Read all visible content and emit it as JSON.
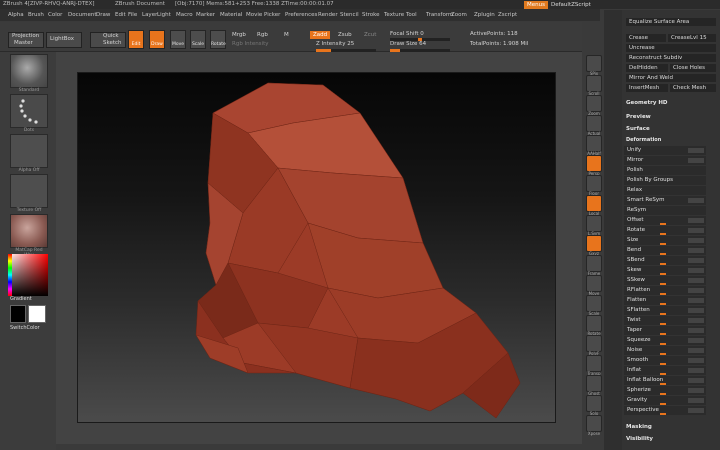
{
  "titlebar": {
    "app": "ZBrush 4[ZIVP-RHVQ-ANRJ-DTEX]",
    "doc": "ZBrush Document",
    "stats": "[Obj:7170] Mems:581+253 Free:1338 ZTime:00:00:01.07",
    "menus": "Menus",
    "script": "DefaultZScript"
  },
  "menubar": [
    "Alpha",
    "Brush",
    "Color",
    "Document",
    "Draw",
    "Edit",
    "File",
    "Layer",
    "Light",
    "Macro",
    "Marker",
    "Material",
    "Movie",
    "Picker",
    "Preferences",
    "Render",
    "Stencil",
    "Stroke",
    "Texture",
    "Tool",
    "Transform",
    "Zoom",
    "Zplugin",
    "Zscript"
  ],
  "toolbar": {
    "projection": "Projection",
    "master": "Master",
    "lightbox": "LightBox",
    "quick": "Quick",
    "sketch": "Sketch",
    "edit": "Edit",
    "draw": "Draw",
    "move": "Move",
    "scale": "Scale",
    "rotate": "Rotate",
    "mrgb": "Mrgb",
    "rgb": "Rgb",
    "m": "M",
    "zadd": "Zadd",
    "zsub": "Zsub",
    "zcut": "Zcut",
    "rgb_intensity": "Rgb Intensity",
    "z_intensity": "Z Intensity 25",
    "focal_shift": "Focal Shift 0",
    "draw_size": "Draw Size 64",
    "active_points": "ActivePoints: 118",
    "total_points": "TotalPoints: 1.908 Mil"
  },
  "leftpanel": {
    "thumbs": [
      "Standard",
      "Dots",
      "Alpha Off",
      "Texture Off",
      "MatCap Red Wax"
    ],
    "gradient": "Gradient",
    "switchcolor": "SwitchColor"
  },
  "rightshelf": [
    "SPix",
    "Scroll",
    "Zoom",
    "Actual",
    "AAHalf",
    "Persp",
    "Floor",
    "Local",
    "L.Sym",
    "Gxyz",
    "Frame",
    "Move",
    "Scale",
    "Rotate",
    "PolyF",
    "Transp",
    "Ghost",
    "Solo",
    "Xpose"
  ],
  "rightpanel": {
    "top": [
      "Equalize Surface Area",
      "Crease",
      "CreaseLvl 15",
      "Uncrease",
      "Reconstruct Subdiv",
      "DelHidden",
      "Close Holes",
      "Mirror And Weld",
      "InsertMesh",
      "Check Mesh"
    ],
    "sections": [
      "Geometry HD",
      "Preview",
      "Surface",
      "Deformation",
      "Masking",
      "Visibility"
    ],
    "unify": "Unify",
    "mirror": "Mirror",
    "polish": "Polish",
    "polish_groups": "Polish By Groups",
    "relax": "Relax",
    "smart_resym": "Smart ReSym",
    "resym": "ReSym",
    "deform_items": [
      "Offset",
      "Rotate",
      "Size",
      "Bend",
      "SBend",
      "Skew",
      "SSkew",
      "RFlatten",
      "Flatten",
      "SFlatten",
      "Twist",
      "Taper",
      "Squeeze",
      "Noise",
      "Smooth",
      "Inflat",
      "Inflat Balloon",
      "Spherize",
      "Gravity",
      "Perspective"
    ],
    "deform_values": [
      0.3,
      0.3,
      0.3,
      0.3,
      0.3,
      0.3,
      0.3,
      0.3,
      0.3,
      0.3,
      0.3,
      0.3,
      0.3,
      0.3,
      0.3,
      0.3,
      0.3,
      0.3,
      0.3,
      0.3
    ]
  },
  "colors": {
    "accent": "#e8741c",
    "mesh": "#9c3b27"
  }
}
